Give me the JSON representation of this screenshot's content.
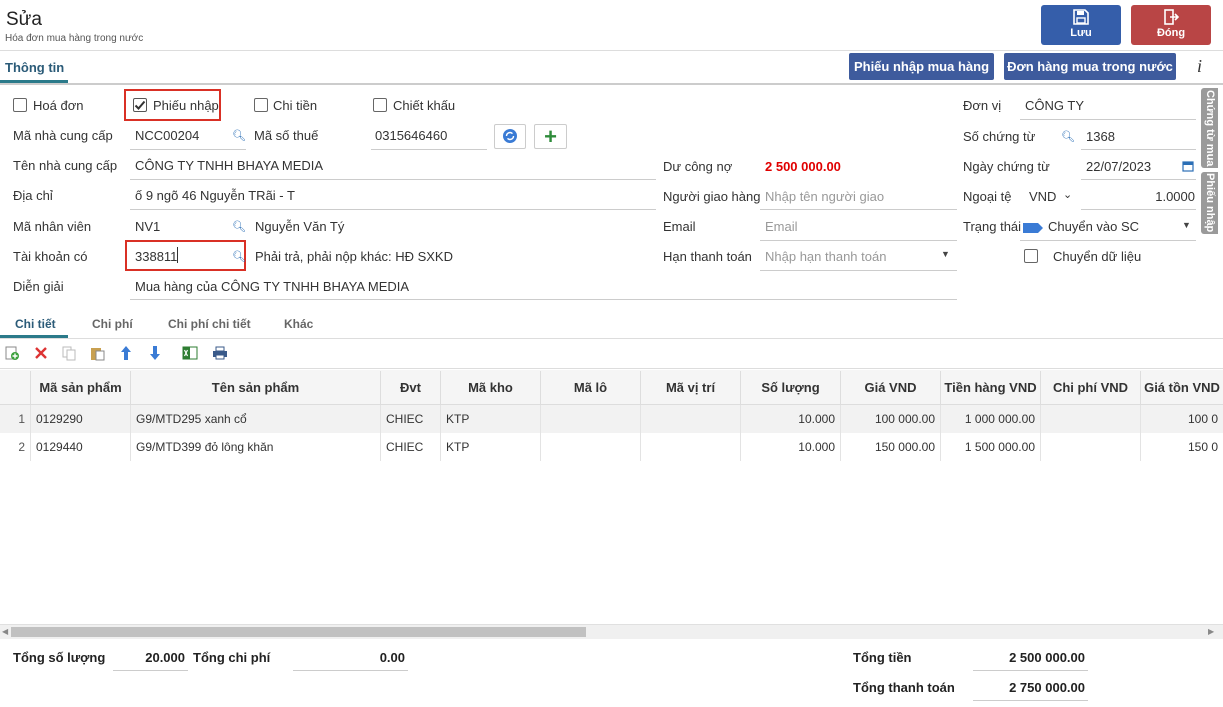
{
  "header": {
    "title": "Sửa",
    "subtitle": "Hóa đơn mua hàng trong nước",
    "save_label": "Lưu",
    "close_label": "Đóng"
  },
  "tabs": {
    "main": "Thông tin",
    "btn_receipt": "Phiếu nhập mua hàng",
    "btn_order": "Đơn hàng mua trong nước",
    "info": "i"
  },
  "side_tabs": [
    "Chứng từ mua",
    "Phiếu nhập"
  ],
  "checks": {
    "invoice": {
      "label": "Hoá đơn",
      "checked": false
    },
    "receipt": {
      "label": "Phiếu nhập",
      "checked": true
    },
    "payment": {
      "label": "Chi tiền",
      "checked": false
    },
    "discount": {
      "label": "Chiết khấu",
      "checked": false
    }
  },
  "form": {
    "supplier_code_label": "Mã nhà cung cấp",
    "supplier_code": "NCC00204",
    "tax_code_label": "Mã số thuế",
    "tax_code": "0315646460",
    "supplier_name_label": "Tên nhà cung cấp",
    "supplier_name": "CÔNG TY TNHH BHAYA MEDIA",
    "address_label": "Địa chỉ",
    "address": "ố 9 ngõ 46 Nguyễn TRãi - T",
    "employee_code_label": "Mã nhân viên",
    "employee_code": "NV1",
    "employee_name": "Nguyễn Văn Tý",
    "credit_account_label": "Tài khoản có",
    "credit_account": "338811",
    "credit_account_desc": "Phải trả, phải nộp khác: HĐ SXKD",
    "description_label": "Diễn giải",
    "description": "Mua hàng của CÔNG TY TNHH BHAYA MEDIA",
    "debt_label": "Dư công nợ",
    "debt": "2 500 000.00",
    "deliverer_label": "Người giao hàng",
    "deliverer_placeholder": "Nhập tên người giao",
    "email_label": "Email",
    "email_placeholder": "Email",
    "due_label": "Hạn thanh toán",
    "due_placeholder": "Nhập hạn thanh toán",
    "unit_label": "Đơn vị",
    "unit": "CÔNG TY",
    "voucher_no_label": "Số chứng từ",
    "voucher_no": "1368",
    "voucher_date_label": "Ngày chứng từ",
    "voucher_date": "22/07/2023",
    "currency_label": "Ngoại tệ",
    "currency": "VND",
    "rate": "1.0000",
    "status_label": "Trạng thái",
    "status": "Chuyển vào SC",
    "transfer_label": "Chuyển dữ liệu",
    "transfer_checked": false
  },
  "subtabs": [
    "Chi tiết",
    "Chi phí",
    "Chi phí chi tiết",
    "Khác"
  ],
  "table": {
    "headers": [
      "Mã sản phẩm",
      "Tên sản phẩm",
      "Đvt",
      "Mã kho",
      "Mã lô",
      "Mã vị trí",
      "Số lượng",
      "Giá VND",
      "Tiền hàng VND",
      "Chi phí VND",
      "Giá tồn VND"
    ],
    "rows": [
      {
        "no": "1",
        "cells": [
          "0129290",
          "G9/MTD295 xanh cổ",
          "CHIEC",
          "KTP",
          "",
          "",
          "10.000",
          "100 000.00",
          "1 000 000.00",
          "",
          "100 0"
        ]
      },
      {
        "no": "2",
        "cells": [
          "0129440",
          "G9/MTD399 đỏ lông khăn",
          "CHIEC",
          "KTP",
          "",
          "",
          "10.000",
          "150 000.00",
          "1 500 000.00",
          "",
          "150 0"
        ]
      }
    ]
  },
  "footer": {
    "total_qty_label": "Tổng số lượng",
    "total_qty": "20.000",
    "total_cost_label": "Tổng chi phí",
    "total_cost": "0.00",
    "total_amount_label": "Tổng tiền",
    "total_amount": "2 500 000.00",
    "total_payment_label": "Tổng thanh toán",
    "total_payment": "2 750 000.00"
  },
  "colors": {
    "accent": "#3e5b9d",
    "close": "#b94545",
    "debt": "#e00000",
    "highlight": "#d93025"
  }
}
